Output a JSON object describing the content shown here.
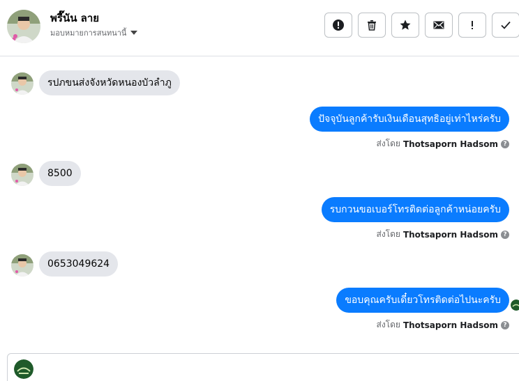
{
  "header": {
    "contact_name": "พรี๊นัน ลาย",
    "assigned_label": "มอบหมายการสนทนานี้",
    "toolbar": [
      {
        "name": "alert-icon"
      },
      {
        "name": "trash-icon"
      },
      {
        "name": "star-icon"
      },
      {
        "name": "mail-icon"
      },
      {
        "name": "exclamation-icon"
      },
      {
        "name": "check-icon"
      }
    ]
  },
  "messages": [
    {
      "direction": "in",
      "text": "รปภขนส่งจังหวัดหนองบัวลำภู"
    },
    {
      "direction": "out",
      "text": "ปัจจุบันลูกค้ารับเงินเดือนสุทธิอยู่เท่าไหร่ครับ",
      "sent_by_prefix": "ส่งโดย",
      "sent_by_name": "Thotsaporn Hadsom"
    },
    {
      "direction": "in",
      "text": "8500"
    },
    {
      "direction": "out",
      "text": "รบกวนขอเบอร์โทรติดต่อลูกค้าหน่อยครับ",
      "sent_by_prefix": "ส่งโดย",
      "sent_by_name": "Thotsaporn Hadsom"
    },
    {
      "direction": "in",
      "text": "0653049624"
    },
    {
      "direction": "out",
      "text": "ขอบคุณครับเดี๋ยวโทรติดต่อไปนะครับ",
      "sent_by_prefix": "ส่งโดย",
      "sent_by_name": "Thotsaporn Hadsom"
    }
  ],
  "colors": {
    "outgoing_bubble": "#0a7cff",
    "incoming_bubble": "#e4e6eb",
    "muted_text": "#65676b"
  }
}
